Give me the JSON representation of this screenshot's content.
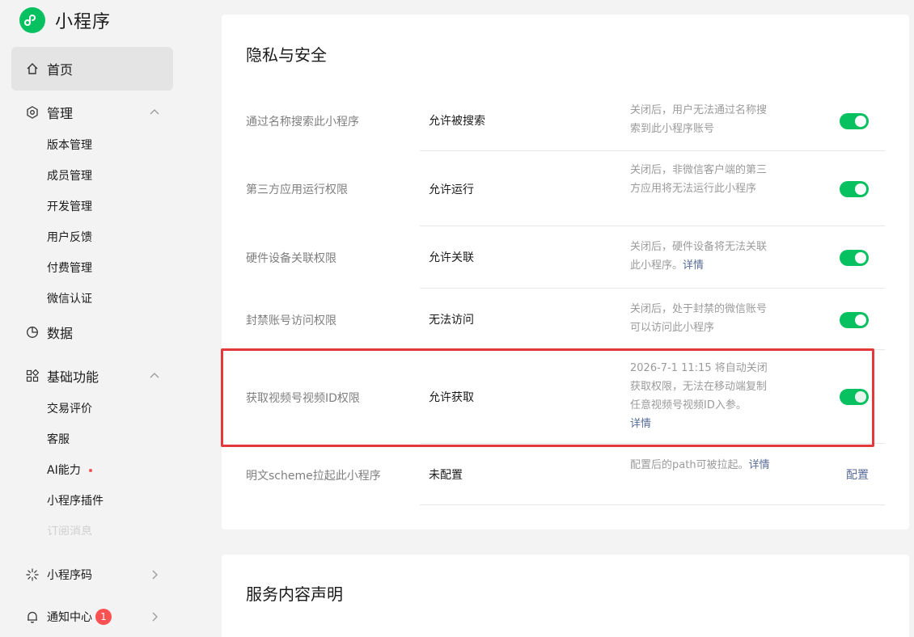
{
  "brand": {
    "title": "小程序",
    "logo_icon": "mini-program-logo"
  },
  "sidebar": {
    "home": "首页",
    "groups": [
      {
        "label": "管理",
        "items": [
          "版本管理",
          "成员管理",
          "开发管理",
          "用户反馈",
          "付费管理",
          "微信认证"
        ]
      },
      {
        "label": "数据",
        "items": []
      },
      {
        "label": "基础功能",
        "items": [
          "交易评价",
          "客服",
          "AI能力",
          "小程序插件",
          "订阅消息"
        ]
      }
    ],
    "bottom": [
      {
        "label": "小程序码"
      },
      {
        "label": "通知中心",
        "badge": "1"
      }
    ]
  },
  "privacy": {
    "title": "隐私与安全",
    "rows": [
      {
        "name": "通过名称搜索此小程序",
        "value": "允许被搜索",
        "desc": "关闭后，用户无法通过名称搜索到此小程序账号",
        "enabled": true
      },
      {
        "name": "第三方应用运行权限",
        "value": "允许运行",
        "desc": "关闭后，非微信客户端的第三方应用将无法运行此小程序",
        "enabled": true
      },
      {
        "name": "硬件设备关联权限",
        "value": "允许关联",
        "desc": "关闭后，硬件设备将无法关联此小程序。",
        "link": "详情",
        "enabled": true
      },
      {
        "name": "封禁账号访问权限",
        "value": "无法访问",
        "desc": "关闭后，处于封禁的微信账号可以访问此小程序",
        "enabled": true
      },
      {
        "name": "获取视频号视频ID权限",
        "value": "允许获取",
        "desc": "2026-7-1 11:15 将自动关闭获取权限，无法在移动端复制任意视频号视频ID入参。",
        "link": "详情",
        "enabled": true
      },
      {
        "name": "明文scheme拉起此小程序",
        "value": "未配置",
        "desc": "配置后的path可被拉起。",
        "link": "详情",
        "action": "配置"
      }
    ]
  },
  "service": {
    "title": "服务内容声明"
  },
  "colors": {
    "accent": "#07c160",
    "link": "#576b95",
    "highlight": "#e4393c",
    "badge": "#fa5151"
  }
}
